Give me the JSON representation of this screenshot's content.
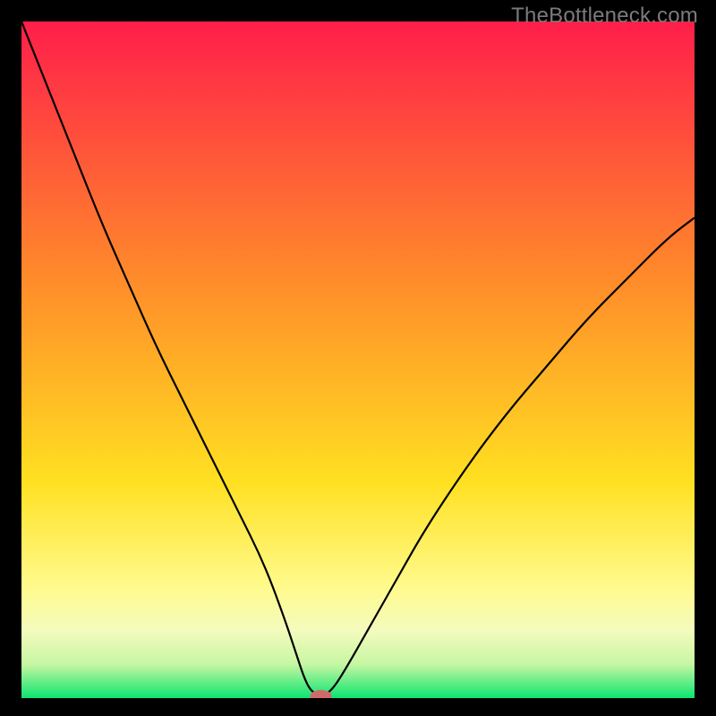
{
  "watermark": "TheBottleneck.com",
  "colors": {
    "gradient_top": "#ff1e4a",
    "gradient_mid1": "#ff8b2a",
    "gradient_mid2": "#ffe021",
    "gradient_band1": "#fffb8f",
    "gradient_band2": "#f4fbbd",
    "gradient_band3": "#c7f6a3",
    "gradient_bottom": "#0ce56f",
    "curve": "#000000",
    "marker": "#cf6a6b",
    "frame": "#000000"
  },
  "chart_data": {
    "type": "line",
    "title": "",
    "xlabel": "",
    "ylabel": "",
    "xlim": [
      0,
      100
    ],
    "ylim": [
      0,
      100
    ],
    "grid": false,
    "legend": false,
    "notes": "Bottleneck-style V chart; pixel-estimated from unlabeled axes.",
    "series": [
      {
        "name": "curve",
        "x": [
          0,
          4,
          8,
          12,
          16,
          20,
          24,
          28,
          32,
          36,
          39,
          41,
          42,
          43,
          44.5,
          46,
          48,
          52,
          56,
          60,
          66,
          72,
          78,
          84,
          90,
          96,
          100
        ],
        "y": [
          100,
          90,
          80,
          70,
          61,
          52,
          44,
          36,
          28,
          20,
          12,
          6,
          3,
          1,
          0.3,
          1,
          4,
          11,
          18,
          25,
          34,
          42,
          49,
          56,
          62,
          68,
          71
        ]
      }
    ],
    "markers": [
      {
        "name": "minimum-marker",
        "x": 44.5,
        "y": 0.3,
        "rx": 1.6,
        "ry": 0.9
      }
    ]
  }
}
